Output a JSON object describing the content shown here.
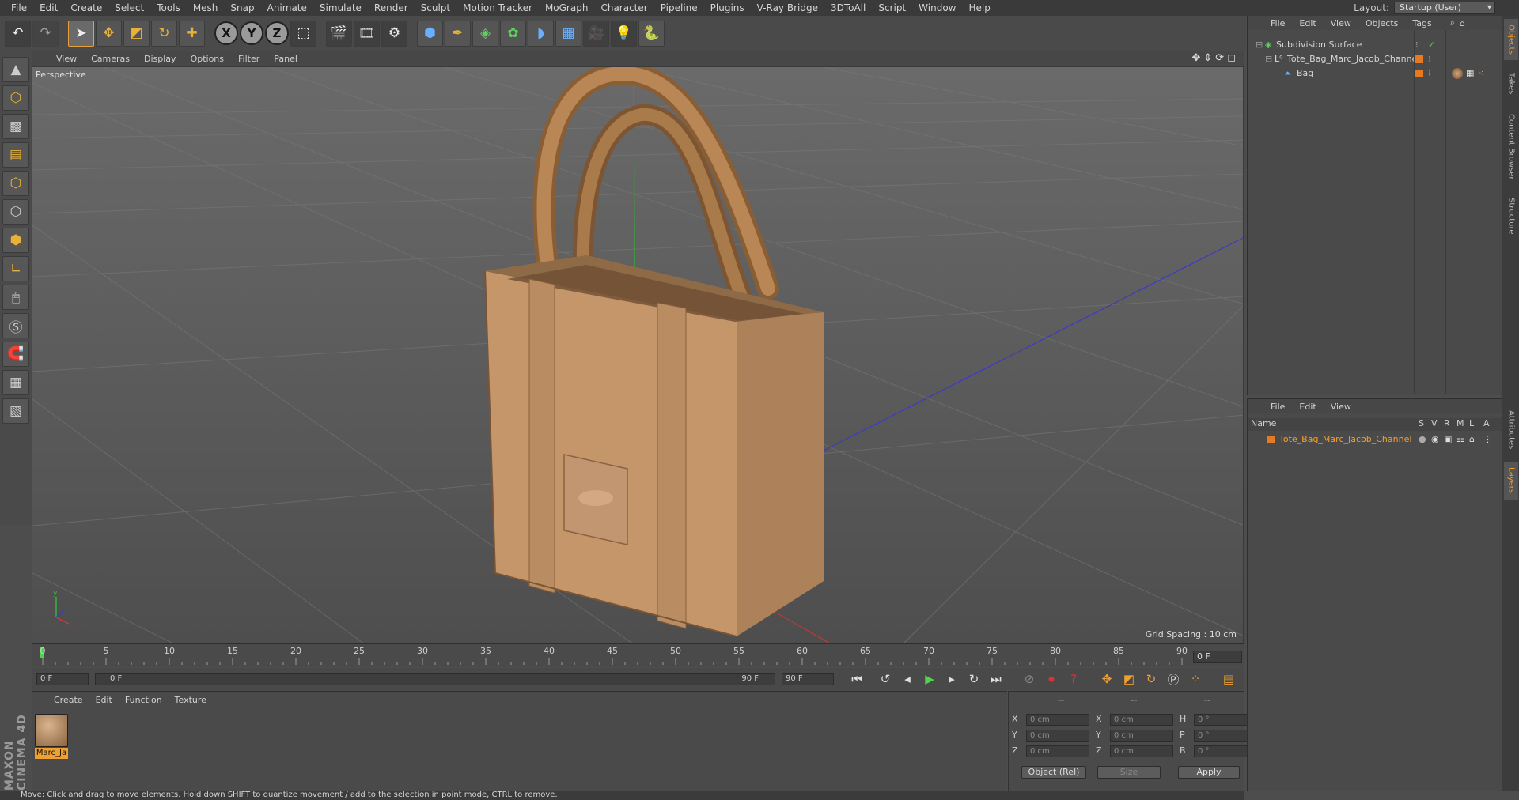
{
  "menu": [
    "File",
    "Edit",
    "Create",
    "Select",
    "Tools",
    "Mesh",
    "Snap",
    "Animate",
    "Simulate",
    "Render",
    "Sculpt",
    "Motion Tracker",
    "MoGraph",
    "Character",
    "Pipeline",
    "Plugins",
    "V-Ray Bridge",
    "3DToAll",
    "Script",
    "Window",
    "Help"
  ],
  "layout": {
    "label": "Layout:",
    "value": "Startup (User)"
  },
  "viewport": {
    "menu": [
      "View",
      "Cameras",
      "Display",
      "Options",
      "Filter",
      "Panel"
    ],
    "label": "Perspective",
    "grid_spacing": "Grid Spacing : 10 cm"
  },
  "timeline": {
    "ticks": [
      "0",
      "5",
      "10",
      "15",
      "20",
      "25",
      "30",
      "35",
      "40",
      "45",
      "50",
      "55",
      "60",
      "65",
      "70",
      "75",
      "80",
      "85",
      "90"
    ],
    "current_frame": "0 F",
    "start": "0 F",
    "range_start": "0 F",
    "range_end": "90 F",
    "end": "90 F"
  },
  "material_panel": {
    "menu": [
      "Create",
      "Edit",
      "Function",
      "Texture"
    ],
    "materials": [
      {
        "name": "Marc_Ja"
      }
    ]
  },
  "coords": {
    "headers": [
      "--",
      "--",
      "--"
    ],
    "rows": [
      {
        "a": "X",
        "av": "0 cm",
        "b": "X",
        "bv": "0 cm",
        "c": "H",
        "cv": "0 °"
      },
      {
        "a": "Y",
        "av": "0 cm",
        "b": "Y",
        "bv": "0 cm",
        "c": "P",
        "cv": "0 °"
      },
      {
        "a": "Z",
        "av": "0 cm",
        "b": "Z",
        "bv": "0 cm",
        "c": "B",
        "cv": "0 °"
      }
    ],
    "mode": "Object (Rel)",
    "size": "Size",
    "apply": "Apply"
  },
  "objects_panel": {
    "menu": [
      "File",
      "Edit",
      "View",
      "Objects",
      "Tags"
    ],
    "items": [
      {
        "name": "Subdivision Surface"
      },
      {
        "name": "Tote_Bag_Marc_Jacob_Channel"
      },
      {
        "name": "Bag"
      }
    ]
  },
  "layers_panel": {
    "menu": [
      "File",
      "Edit",
      "View"
    ],
    "columns": [
      "Name",
      "S",
      "V",
      "R",
      "M",
      "L",
      "A"
    ],
    "rows": [
      {
        "name": "Tote_Bag_Marc_Jacob_Channel"
      }
    ]
  },
  "side_tabs": [
    "Objects",
    "Takes",
    "Content Browser",
    "Structure",
    "Attributes",
    "Layers"
  ],
  "maxon": "MAXON CINEMA 4D",
  "status": "Move: Click and drag to move elements. Hold down SHIFT to quantize movement / add to the selection in point mode, CTRL to remove.",
  "colors": {
    "accent": "#f0a030",
    "bag": "#c4966a",
    "play": "#4fd44f"
  }
}
